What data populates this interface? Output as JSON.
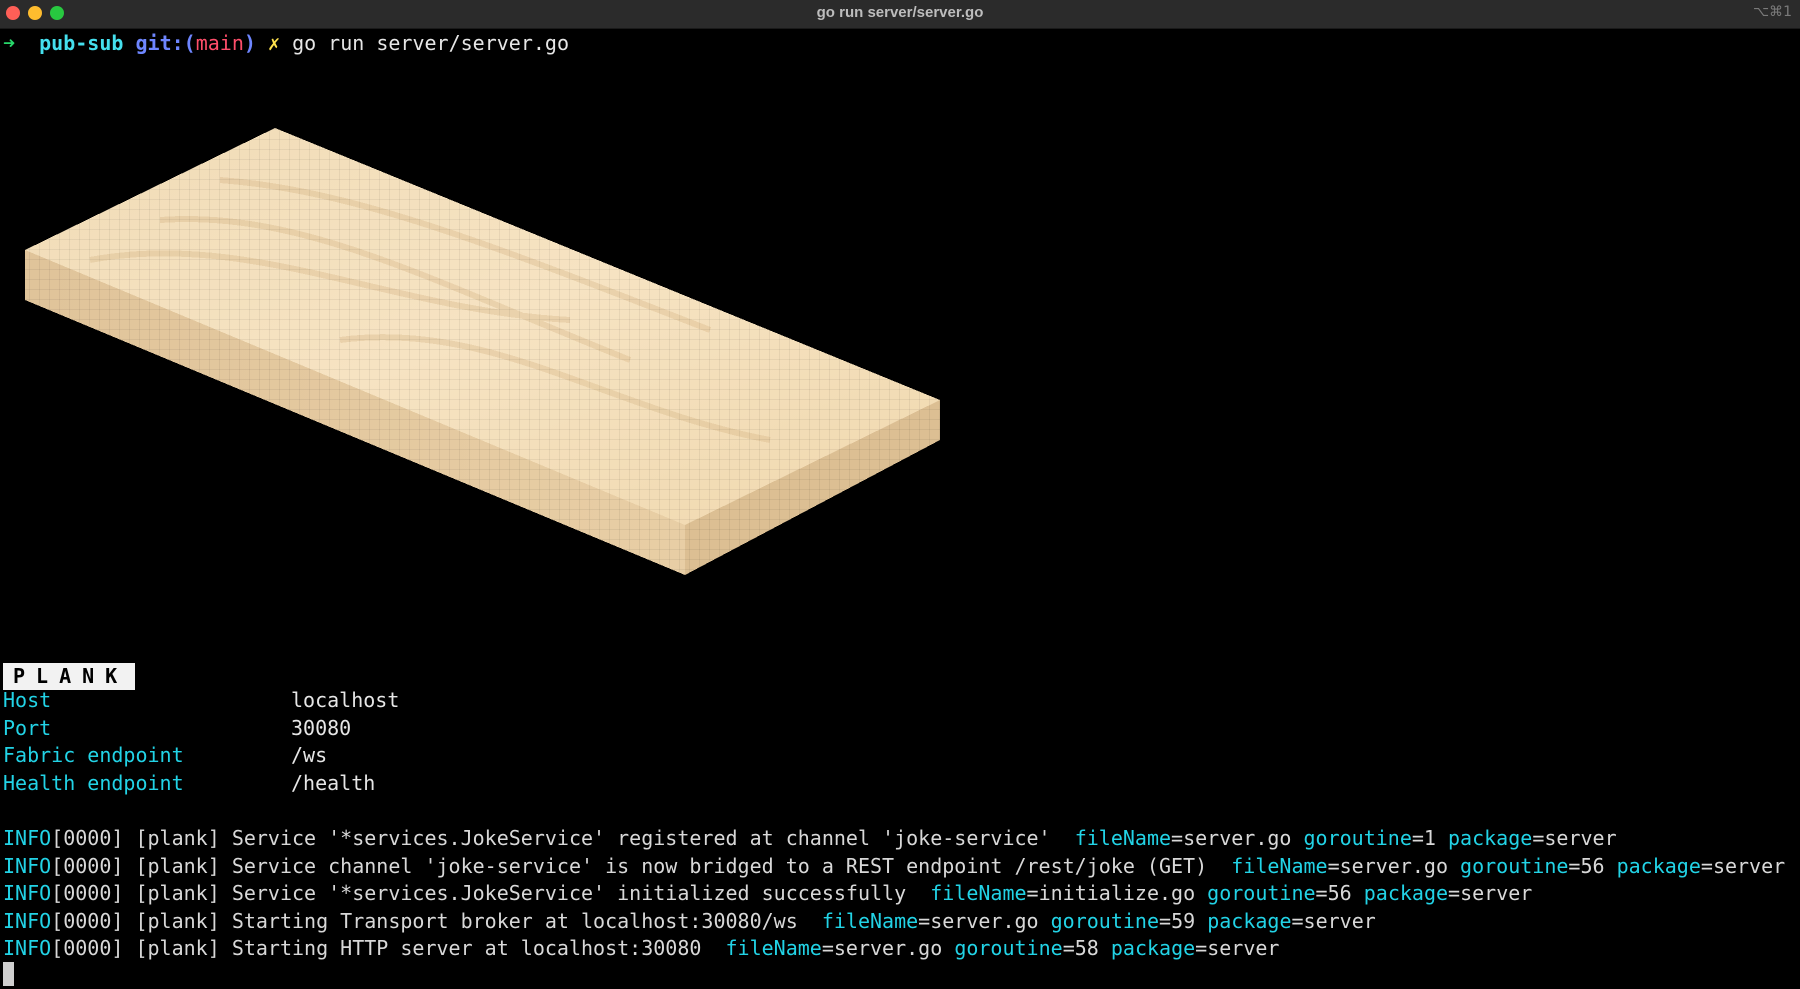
{
  "window": {
    "title": "go run server/server.go",
    "shortcut": "⌥⌘1"
  },
  "prompt": {
    "arrow": "➜",
    "dir": "pub-sub",
    "git_prefix": "git:(",
    "branch": "main",
    "git_suffix": ")",
    "dirty": "✗",
    "command": "go run server/server.go"
  },
  "banner": {
    "label": "PLANK"
  },
  "config": [
    {
      "key": "Host",
      "value": "localhost"
    },
    {
      "key": "Port",
      "value": "30080"
    },
    {
      "key": "Fabric endpoint",
      "value": "/ws"
    },
    {
      "key": "Health endpoint",
      "value": "/health"
    }
  ],
  "logs": [
    {
      "level": "INFO",
      "code": "[0000]",
      "tag": "[plank]",
      "message": "Service '*services.JokeService' registered at channel 'joke-service'",
      "fields": [
        {
          "k": "fileName",
          "v": "server.go"
        },
        {
          "k": "goroutine",
          "v": "1"
        },
        {
          "k": "package",
          "v": "server"
        }
      ]
    },
    {
      "level": "INFO",
      "code": "[0000]",
      "tag": "[plank]",
      "message": "Service channel 'joke-service' is now bridged to a REST endpoint /rest/joke (GET)",
      "fields": [
        {
          "k": "fileName",
          "v": "server.go"
        },
        {
          "k": "goroutine",
          "v": "56"
        },
        {
          "k": "package",
          "v": "server"
        }
      ]
    },
    {
      "level": "INFO",
      "code": "[0000]",
      "tag": "[plank]",
      "message": "Service '*services.JokeService' initialized successfully",
      "fields": [
        {
          "k": "fileName",
          "v": "initialize.go"
        },
        {
          "k": "goroutine",
          "v": "56"
        },
        {
          "k": "package",
          "v": "server"
        }
      ]
    },
    {
      "level": "INFO",
      "code": "[0000]",
      "tag": "[plank]",
      "message": "Starting Transport broker at localhost:30080/ws",
      "fields": [
        {
          "k": "fileName",
          "v": "server.go"
        },
        {
          "k": "goroutine",
          "v": "59"
        },
        {
          "k": "package",
          "v": "server"
        }
      ]
    },
    {
      "level": "INFO",
      "code": "[0000]",
      "tag": "[plank]",
      "message": "Starting HTTP server at localhost:30080",
      "fields": [
        {
          "k": "fileName",
          "v": "server.go"
        },
        {
          "k": "goroutine",
          "v": "58"
        },
        {
          "k": "package",
          "v": "server"
        }
      ]
    }
  ],
  "colors": {
    "background": "#000000",
    "cyan": "#22d3e6",
    "prompt_green": "#27d76a",
    "git_blue": "#6e86ff",
    "branch_red": "#ff4e6a",
    "dirty_yellow": "#ffe24d",
    "plank_wood": "#f2dcb5"
  }
}
